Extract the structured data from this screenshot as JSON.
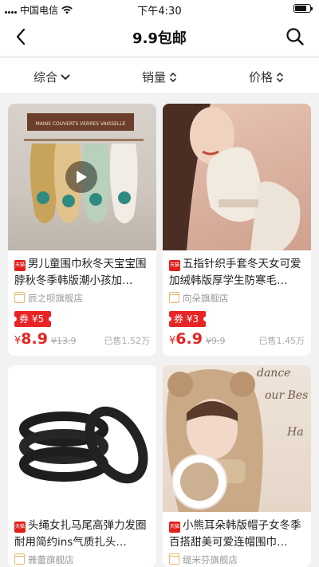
{
  "status_bar": {
    "carrier": "中国电信",
    "time": "下午4:30"
  },
  "nav": {
    "title": "9.9包邮",
    "back_icon": "chevron-left-icon",
    "search_icon": "search-icon"
  },
  "sort": [
    {
      "label": "综合",
      "icon": "chevron-down-icon"
    },
    {
      "label": "销量",
      "icon": "sort-updown-icon"
    },
    {
      "label": "价格",
      "icon": "sort-updown-icon"
    }
  ],
  "products": [
    {
      "title": "男儿童围巾秋冬天宝宝围脖秋冬季韩版潮小孩加…",
      "shop": "辰之呗旗舰店",
      "coupon": "券 ¥5",
      "yen": "¥",
      "price": "8.9",
      "orig_price": "¥13.9",
      "sold": "已售1.52万",
      "badge": "天猫",
      "has_video": true
    },
    {
      "title": "五指针织手套冬天女可爱加绒韩版厚学生防寒毛…",
      "shop": "向朵旗舰店",
      "coupon": "券 ¥3",
      "yen": "¥",
      "price": "6.9",
      "orig_price": "¥9.9",
      "sold": "已售1.45万",
      "badge": "天猫",
      "has_video": false
    },
    {
      "title": "头绳女扎马尾高弹力发圈耐用简约ins气质扎头…",
      "shop": "雅蕾旗舰店",
      "badge": "天猫"
    },
    {
      "title": "小熊耳朵韩版帽子女冬季百搭甜美可爱连帽围巾…",
      "shop": "缇米芬旗舰店",
      "badge": "天猫",
      "image_text": [
        "dance",
        "our Bes",
        "Ha"
      ]
    }
  ],
  "image_sign_text": "MAINS COUVERTS VERRES VAISSELLE",
  "colors": {
    "accent": "#e82424",
    "shop_icon": "#e9b86a",
    "background": "#f2f2f2"
  }
}
